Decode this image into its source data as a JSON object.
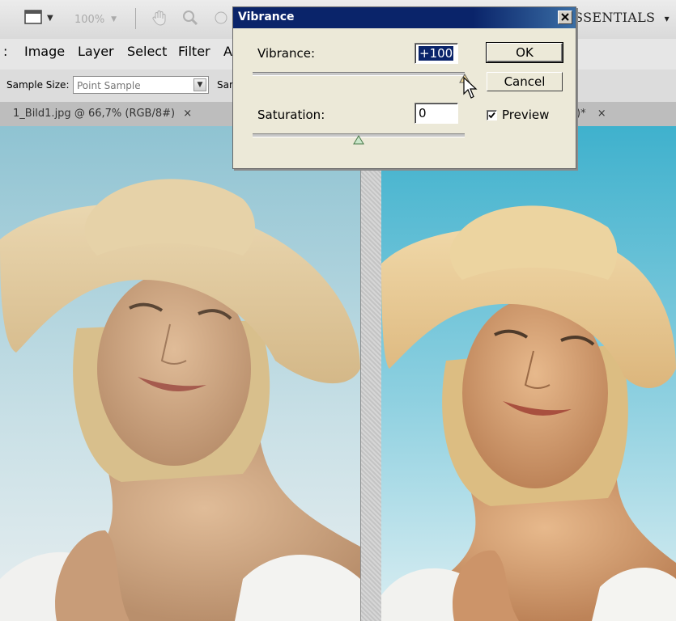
{
  "appbar": {
    "zoom_value": "100%",
    "workspace_label": "ESSENTIALS",
    "workspace_arrow": "▾"
  },
  "menu": {
    "items": [
      "Image",
      "Layer",
      "Select",
      "Filter",
      "A"
    ],
    "left_fragment": ":"
  },
  "options": {
    "sample_size_label": "Sample Size:",
    "sample_size_value": "Point Sample",
    "sample_label_trunc": "Sar"
  },
  "tabs": {
    "left_tab": "1_Bild1.jpg @ 66,7% (RGB/8#)",
    "left_close": "×",
    "right_tab_trunc": ")*",
    "right_close": "×"
  },
  "dialog": {
    "title": "Vibrance",
    "vibrance_label": "Vibrance:",
    "vibrance_value": "+100",
    "vibrance_level": 1.0,
    "saturation_label": "Saturation:",
    "saturation_value": "0",
    "saturation_level": 0.5,
    "ok_label": "OK",
    "cancel_label": "Cancel",
    "preview_label": "Preview",
    "preview_checked": true
  },
  "icons": {
    "screen_mode": "screen-mode-icon",
    "hand": "hand-icon",
    "zoom": "zoom-icon",
    "rotate": "rotate-view-icon",
    "close": "close-icon",
    "cursor": "arrow-cursor-icon"
  },
  "colors": {
    "title_bar": "#0a246a",
    "dialog_bg": "#ece9d8",
    "sky_left": "#9cc9d6",
    "sky_right": "#4fb6cf"
  }
}
